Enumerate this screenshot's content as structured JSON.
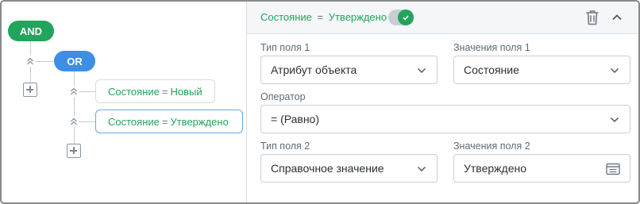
{
  "tree": {
    "and_label": "AND",
    "or_label": "OR",
    "conditions": [
      {
        "field": "Состояние",
        "operator": "=",
        "value": "Новый"
      },
      {
        "field": "Состояние",
        "operator": "=",
        "value": "Утверждено"
      }
    ]
  },
  "panel": {
    "header": {
      "field": "Состояние",
      "operator": "=",
      "value": "Утверждено",
      "toggle_on": true
    },
    "field_type_1": {
      "label": "Тип поля 1",
      "value": "Атрибут объекта"
    },
    "field_values_1": {
      "label": "Значения поля 1",
      "value": "Состояние"
    },
    "operator": {
      "label": "Оператор",
      "value": "= (Равно)"
    },
    "field_type_2": {
      "label": "Тип поля 2",
      "value": "Справочное значение"
    },
    "field_values_2": {
      "label": "Значения поля 2",
      "value": "Утверждено"
    }
  },
  "colors": {
    "and_pill": "#21a45c",
    "or_pill": "#3d8ee6",
    "condition_text": "#21a45c",
    "active_border": "#6aa8e0"
  },
  "icons": [
    "chevrons-up-icon",
    "plus-square-icon",
    "check-icon",
    "trash-icon",
    "chevron-up-icon",
    "chevron-down-icon",
    "list-picker-icon"
  ]
}
